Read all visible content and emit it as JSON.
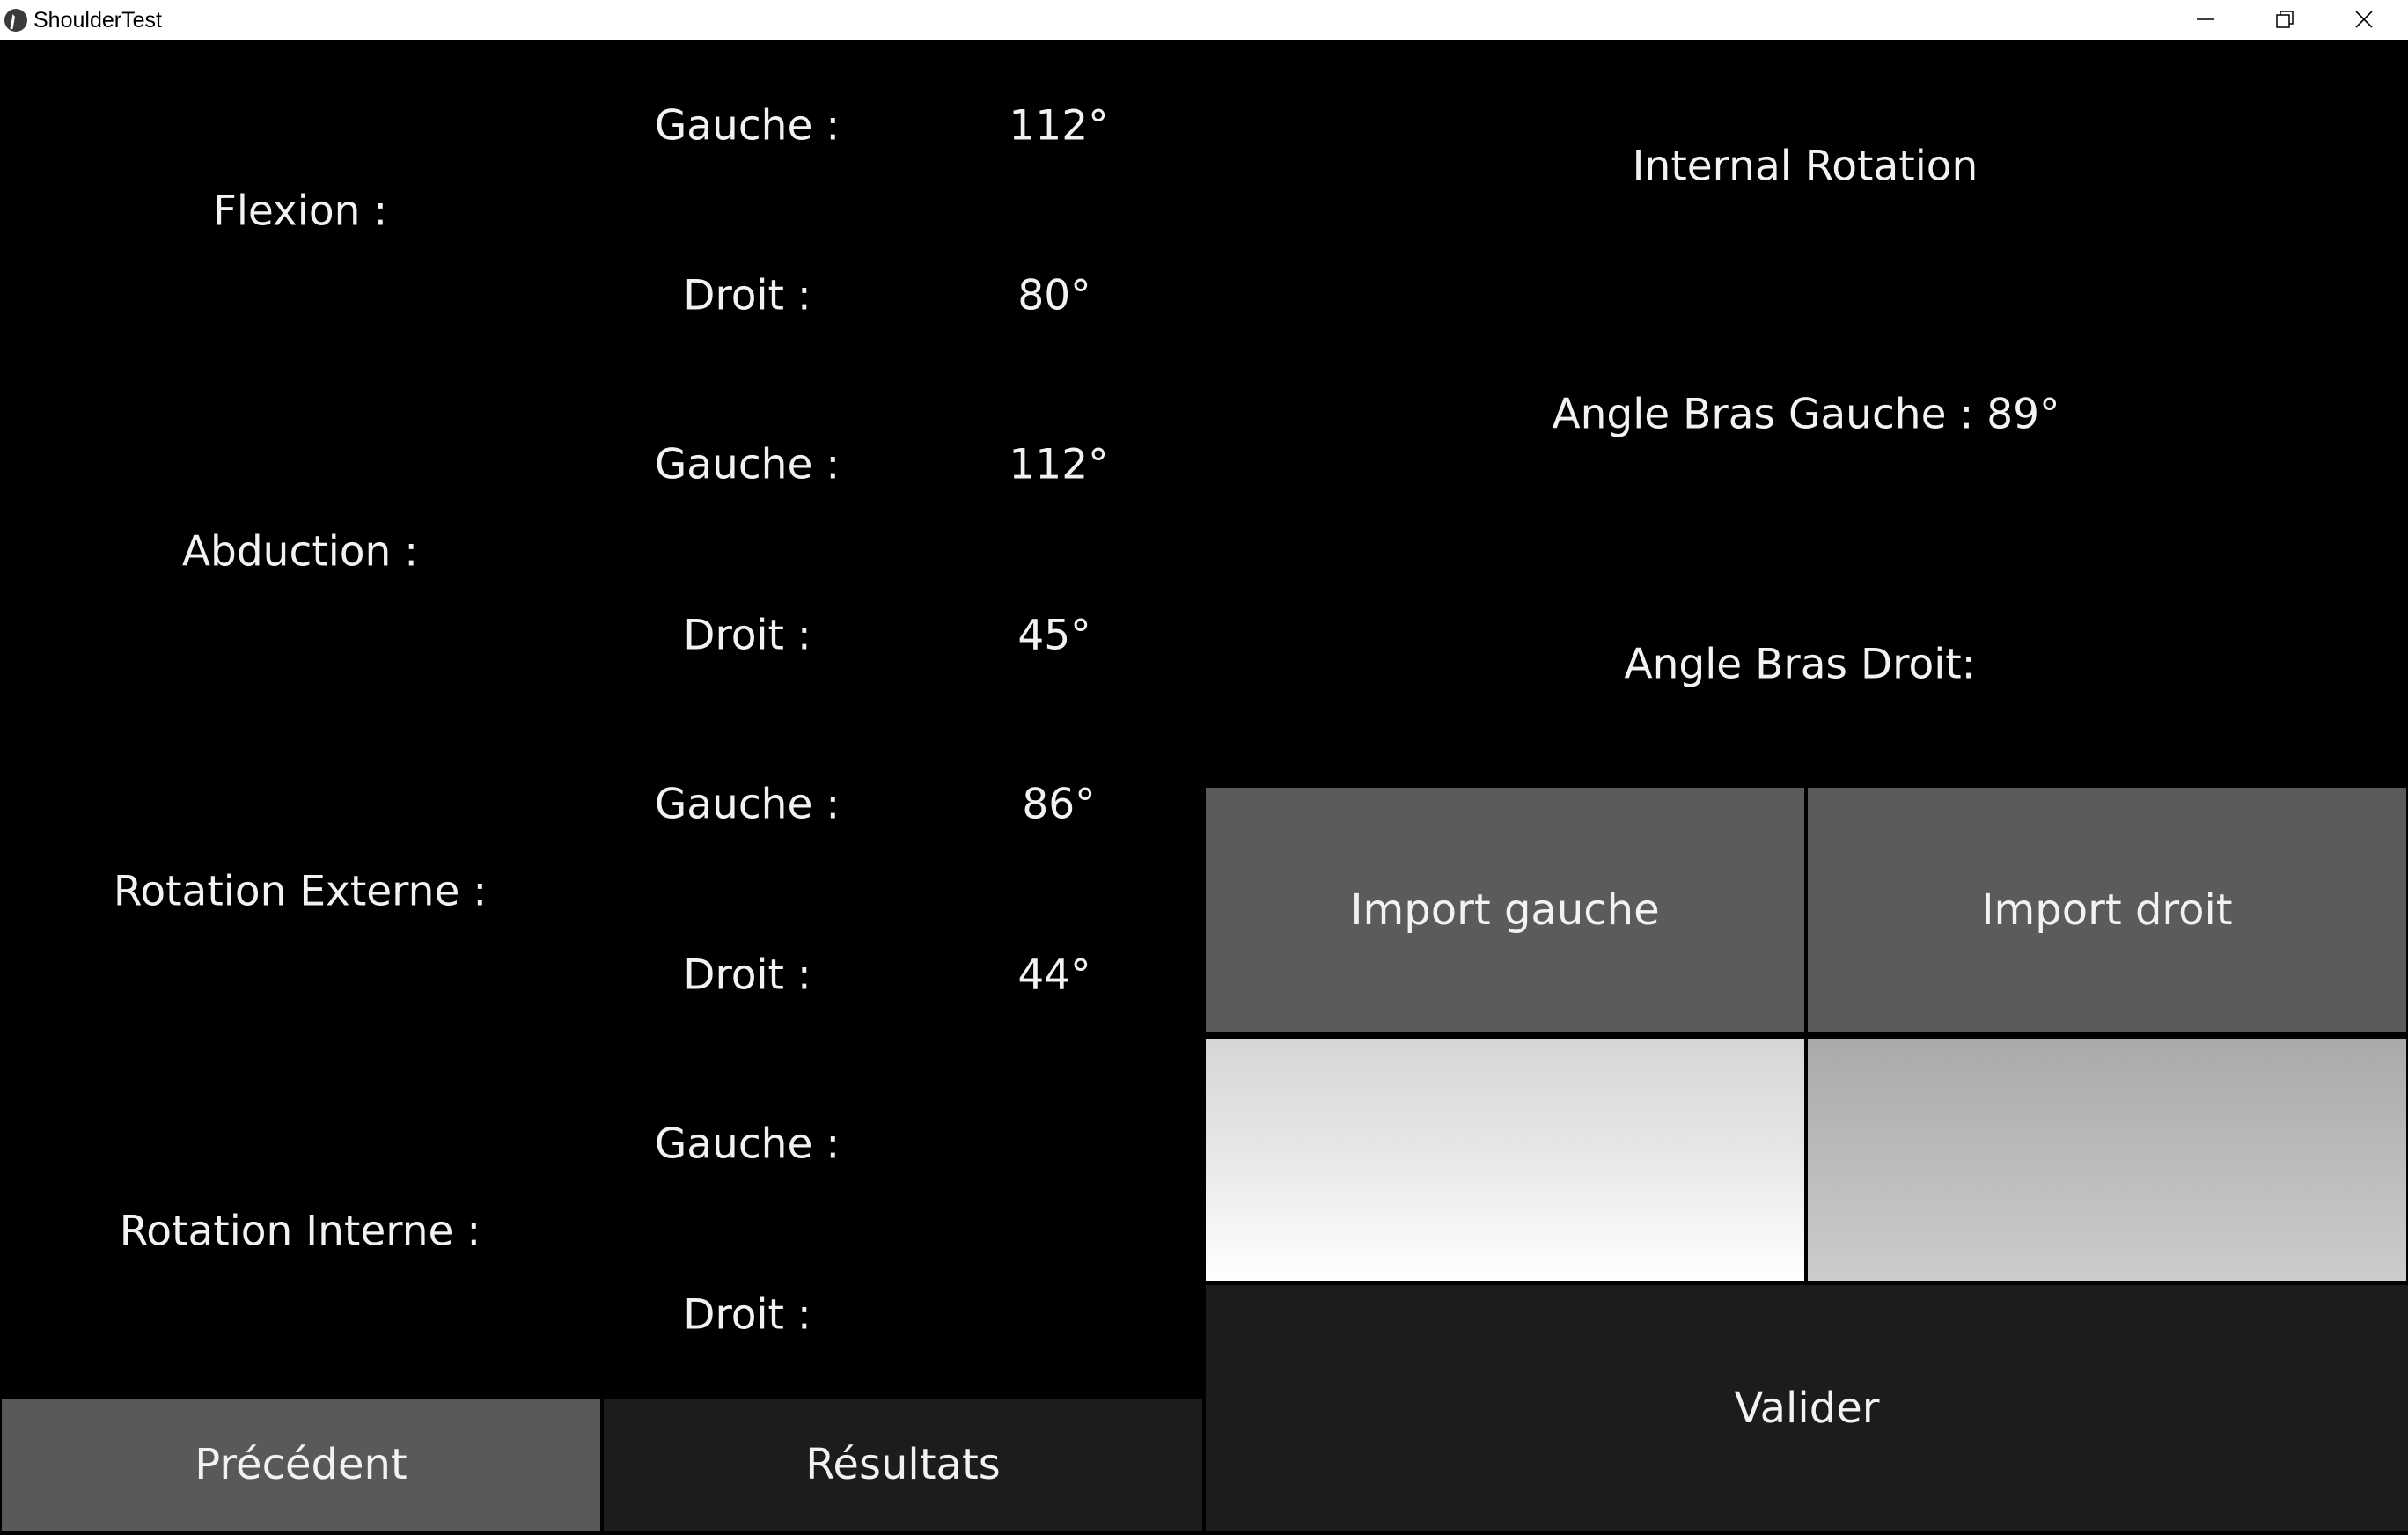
{
  "window": {
    "title": "ShoulderTest",
    "controls": {
      "minimize": "minimize-icon",
      "maximize": "restore-icon",
      "close": "close-icon"
    }
  },
  "measurements": [
    {
      "label": "Flexion :",
      "gauche_label": "Gauche :",
      "gauche_value": "112°",
      "droit_label": "Droit :",
      "droit_value": "80°"
    },
    {
      "label": "Abduction :",
      "gauche_label": "Gauche :",
      "gauche_value": "112°",
      "droit_label": "Droit :",
      "droit_value": "45°"
    },
    {
      "label": "Rotation Externe :",
      "gauche_label": "Gauche :",
      "gauche_value": "86°",
      "droit_label": "Droit :",
      "droit_value": "44°"
    },
    {
      "label": "Rotation Interne :",
      "gauche_label": "Gauche :",
      "gauche_value": "",
      "droit_label": "Droit :",
      "droit_value": ""
    }
  ],
  "nav": {
    "precedent_label": "Précédent",
    "resultats_label": "Résultats"
  },
  "panel": {
    "title": "Internal Rotation",
    "angle_gauche": "Angle Bras Gauche : 89°",
    "angle_droit": "Angle Bras Droit:",
    "import_gauche_label": "Import gauche",
    "import_droit_label": "Import droit",
    "valider_label": "Valider"
  }
}
